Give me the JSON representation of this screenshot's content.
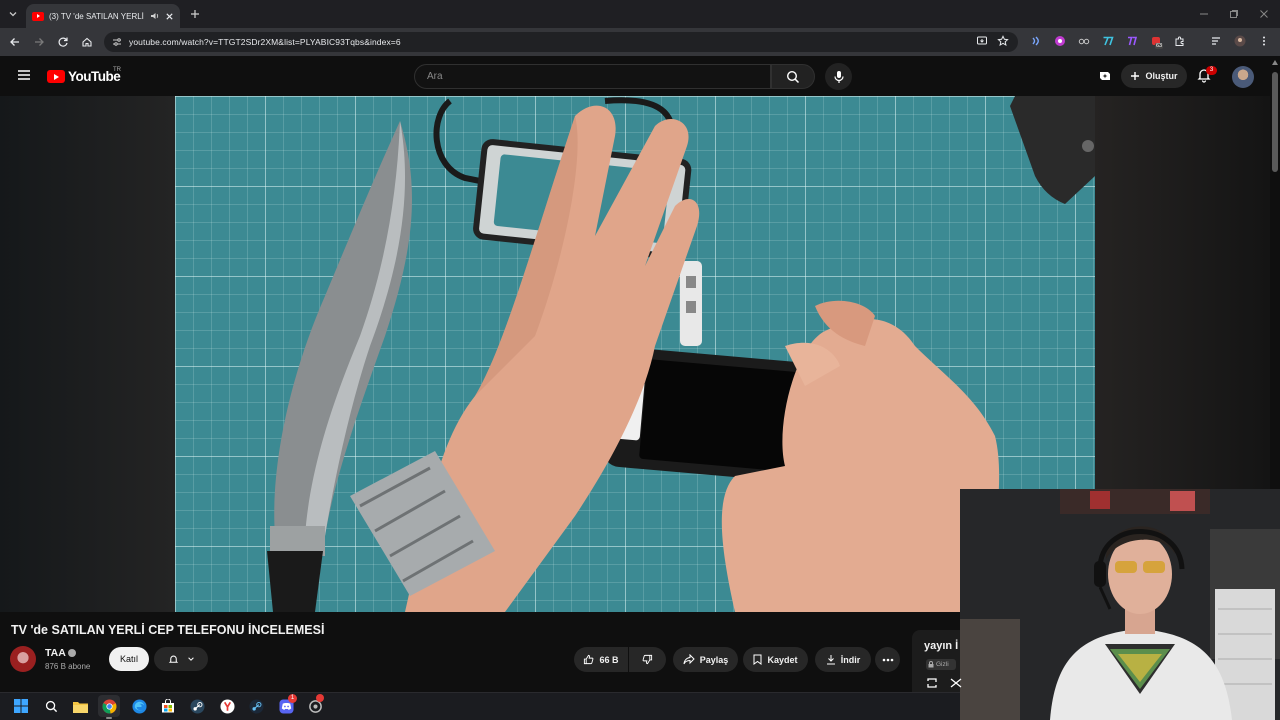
{
  "browser": {
    "tab_title": "(3) TV 'de SATILAN YERLİ C…",
    "url": "youtube.com/watch?v=TTGT2SDr2XM&list=PLYABIC93Tqbs&index=6",
    "extension_badge": "63"
  },
  "youtube": {
    "logo_text": "YouTube",
    "country_code": "TR",
    "search_placeholder": "Ara",
    "create_label": "Oluştur",
    "notification_count": "3"
  },
  "video": {
    "title": "TV 'de SATILAN YERLİ CEP TELEFONU İNCELEMESİ",
    "channel_name": "TAA",
    "subscribers": "876 B abone",
    "join_label": "Katıl",
    "like_count": "66 B",
    "share_label": "Paylaş",
    "save_label": "Kaydet",
    "download_label": "İndir"
  },
  "playlist": {
    "title_fragment": "yayın İ",
    "privacy_label": "Gizli"
  },
  "colors": {
    "accent_red": "#ff0000",
    "cutting_mat": "#3c8a93",
    "background": "#0f0f0f"
  },
  "taskbar": {
    "discord_badge": "1"
  }
}
